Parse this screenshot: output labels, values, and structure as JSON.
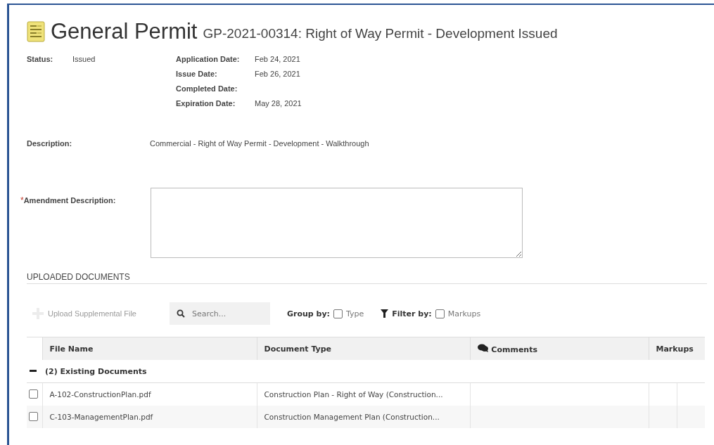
{
  "header": {
    "title": "General Permit",
    "subtitle": "GP-2021-00314: Right of Way Permit - Development Issued"
  },
  "status": {
    "label": "Status:",
    "value": "Issued"
  },
  "dates": [
    {
      "label": "Application Date:",
      "value": "Feb 24, 2021"
    },
    {
      "label": "Issue Date:",
      "value": "Feb 26, 2021"
    },
    {
      "label": "Completed Date:"
    },
    {
      "label": "Expiration Date:",
      "value": "May 28, 2021"
    }
  ],
  "description": {
    "label": "Description:",
    "value": "Commercial - Right of Way Permit - Development - Walkthrough"
  },
  "amendment": {
    "required_mark": "*",
    "label": "Amendment Description:",
    "required": true
  },
  "section_title": "UPLOADED DOCUMENTS",
  "toolbar": {
    "upload": {
      "label": "Upload Supplemental File",
      "disabled": true
    },
    "search": {
      "placeholder": "Search..."
    },
    "group_by": {
      "label": "Group by:",
      "option": "Type",
      "checked": false
    },
    "filter_by": {
      "label": "Filter by:",
      "option": "Markups",
      "checked": false
    }
  },
  "table": {
    "columns": [
      "File Name",
      "Document Type",
      "Comments",
      "Markups"
    ],
    "group": {
      "label": "(2) Existing Documents",
      "expanded": true
    },
    "rows": [
      {
        "checked": false,
        "file_name": "A-102-ConstructionPlan.pdf",
        "document_type": "Construction Plan - Right of Way (Construction..."
      },
      {
        "checked": false,
        "file_name": "C-103-ManagementPlan.pdf",
        "document_type": "Construction Management Plan (Construction..."
      }
    ]
  }
}
